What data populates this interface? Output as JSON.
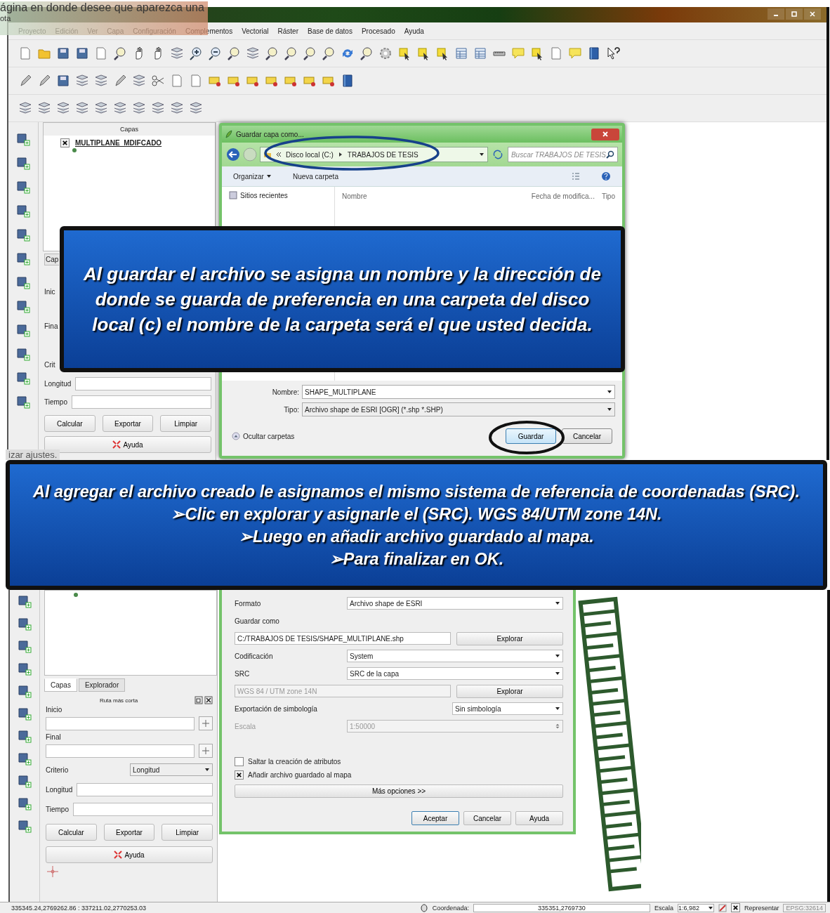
{
  "document_text": {
    "top_line": "ágina en donde desee que aparezca una",
    "second_line": "ota",
    "middle_line": "izar ajustes."
  },
  "top_screen": {
    "menu": [
      "Proyecto",
      "Edición",
      "Ver",
      "Capa",
      "Configuración",
      "Complementos",
      "Vectorial",
      "Ráster",
      "Base de datos",
      "Procesado",
      "Ayuda"
    ],
    "layers_panel": {
      "title": "Capas",
      "layers": [
        {
          "name": "MULTIPLANE_MDIFCADO",
          "checked": true
        }
      ]
    },
    "route_panel": {
      "tab": "Cap",
      "labels": [
        "Inic",
        "Fina",
        "Crit"
      ],
      "length_label": "Longitud",
      "time_label": "Tiempo",
      "buttons": [
        "Calcular",
        "Exportar",
        "Limpiar"
      ],
      "help_button": "Ayuda"
    },
    "save_dialog": {
      "title": "Guardar capa como...",
      "path": [
        "Disco local (C:)",
        "TRABAJOS DE TESIS"
      ],
      "search_placeholder": "Buscar TRABAJOS DE TESIS",
      "commands": [
        "Organizar",
        "Nueva carpeta"
      ],
      "nav_items": [
        "Sitios recientes"
      ],
      "columns": [
        "Nombre",
        "Fecha de modifica...",
        "Tipo"
      ],
      "name_label": "Nombre:",
      "name_value": "SHAPE_MULTIPLANE",
      "type_label": "Tipo:",
      "type_value": "Archivo shape de ESRI [OGR] (*.shp *.SHP)",
      "hide_folders": "Ocultar carpetas",
      "buttons": [
        {
          "label": "Guardar",
          "kind": "primary"
        },
        {
          "label": "Cancelar",
          "kind": "normal"
        }
      ]
    },
    "callout": "Al guardar el archivo se asigna un nombre y la dirección de donde se guarda de preferencia en una carpeta del disco local (c) el nombre de la carpeta será el que usted decida."
  },
  "bottom_screen": {
    "callout": {
      "heading": "Al agregar el archivo creado le asignamos el mismo sistema de referencia de coordenadas (SRC).",
      "bullets": [
        "➢Clic en explorar y asignarle el (SRC). WGS 84/UTM zone 14N.",
        "➢Luego en añadir archivo guardado al mapa.",
        "➢Para finalizar en OK."
      ]
    },
    "dock_tabs": [
      {
        "label": "Capas",
        "selected": true
      },
      {
        "label": "Explorador",
        "selected": false
      }
    ],
    "route_panel": {
      "title": "Ruta más corta",
      "start_label": "Inicio",
      "end_label": "Final",
      "criterion_label": "Criterio",
      "criterion_value": "Longitud",
      "length_label": "Longitud",
      "time_label": "Tiempo",
      "buttons": [
        "Calcular",
        "Exportar",
        "Limpiar"
      ],
      "help_button": "Ayuda"
    },
    "export_dialog": {
      "rows": [
        {
          "kind": "select",
          "label": "Formato",
          "value": "Archivo shape de ESRI"
        },
        {
          "kind": "heading",
          "label": "Guardar como"
        },
        {
          "kind": "path",
          "value": "C:/TRABAJOS DE TESIS/SHAPE_MULTIPLANE.shp",
          "button": "Explorar",
          "disabled": false
        },
        {
          "kind": "select",
          "label": "Codificación",
          "value": "System"
        },
        {
          "kind": "select",
          "label": "SRC",
          "value": "SRC de la capa"
        },
        {
          "kind": "path",
          "value": "WGS 84 / UTM zone 14N",
          "button": "Explorar",
          "disabled": true
        },
        {
          "kind": "short_select",
          "label": "Exportación de simbología",
          "value": "Sin simbología"
        },
        {
          "kind": "spin",
          "label": "Escala",
          "value": "1:50000",
          "disabled": true
        }
      ],
      "checkboxes": [
        {
          "label": "Saltar la creación de atributos",
          "checked": false
        },
        {
          "label": "Añadir archivo guardado al mapa",
          "checked": true
        }
      ],
      "more_button": "Más opciones >>",
      "buttons": [
        {
          "label": "Aceptar",
          "kind": "primary"
        },
        {
          "label": "Cancelar",
          "kind": "normal"
        },
        {
          "label": "Ayuda",
          "kind": "normal"
        }
      ]
    },
    "status_bar": {
      "extent": "335345.24,2769262.86 : 337211.02,2770253.03",
      "coordinate_label": "Coordenada:",
      "coordinate_value": "335351,2769730",
      "scale_label": "Escala",
      "scale_value": "1:6,982",
      "render_label": "Representar",
      "render_checked": true,
      "crs": "EPSG:32614"
    }
  }
}
